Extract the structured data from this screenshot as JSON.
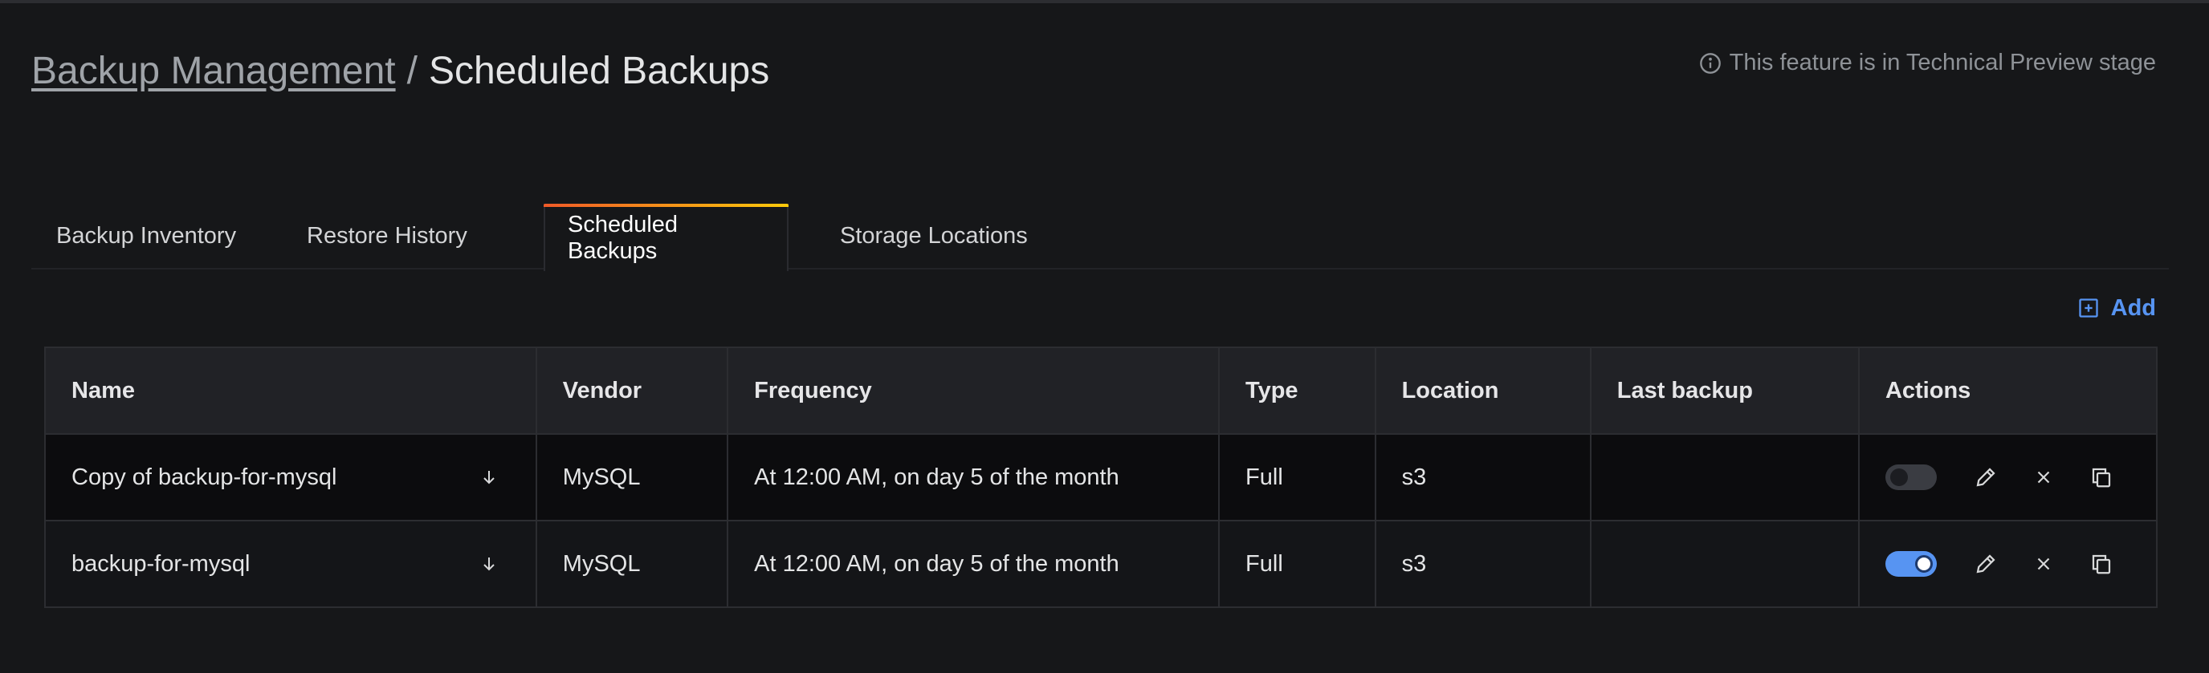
{
  "breadcrumb": {
    "parent": "Backup Management",
    "separator": "/",
    "current": "Scheduled Backups"
  },
  "preview_notice": "This feature is in Technical Preview stage",
  "tabs": [
    {
      "label": "Backup Inventory",
      "active": false
    },
    {
      "label": "Restore History",
      "active": false
    },
    {
      "label": "Scheduled Backups",
      "active": true
    },
    {
      "label": "Storage Locations",
      "active": false
    }
  ],
  "add_label": "Add",
  "table": {
    "headers": [
      "Name",
      "Vendor",
      "Frequency",
      "Type",
      "Location",
      "Last backup",
      "Actions"
    ],
    "rows": [
      {
        "name": "Copy of backup-for-mysql",
        "vendor": "MySQL",
        "frequency": "At 12:00 AM, on day 5 of the month",
        "type": "Full",
        "location": "s3",
        "last_backup": "",
        "enabled": false
      },
      {
        "name": "backup-for-mysql",
        "vendor": "MySQL",
        "frequency": "At 12:00 AM, on day 5 of the month",
        "type": "Full",
        "location": "s3",
        "last_backup": "",
        "enabled": true
      }
    ]
  },
  "colors": {
    "accent": "#5794f2",
    "tab_gradient_start": "#f05a28",
    "tab_gradient_end": "#fbca0a",
    "background": "#161719"
  },
  "icons": [
    "info-icon",
    "add-square-icon",
    "arrow-down-icon",
    "pencil-icon",
    "close-icon",
    "copy-icon"
  ]
}
